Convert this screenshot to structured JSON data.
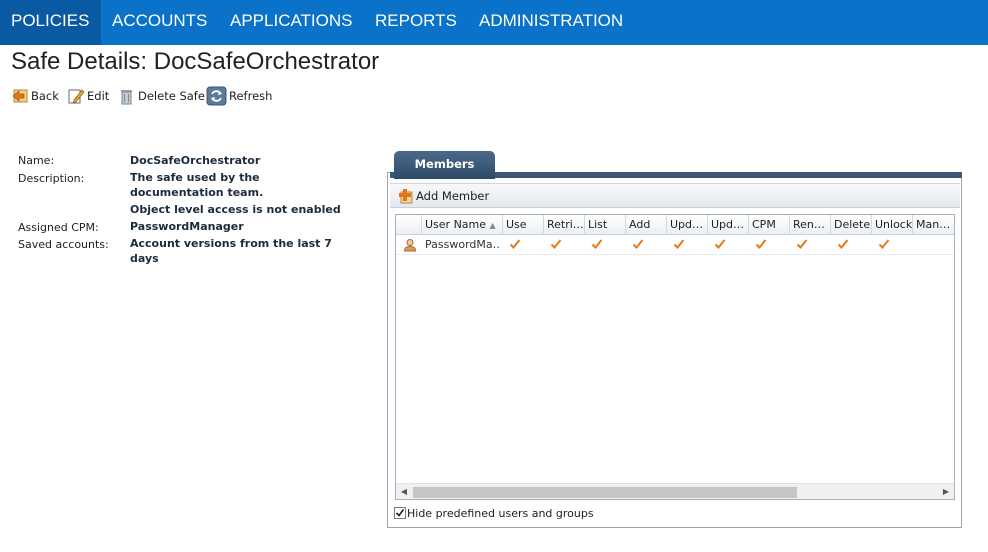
{
  "nav": {
    "items": [
      "POLICIES",
      "ACCOUNTS",
      "APPLICATIONS",
      "REPORTS",
      "ADMINISTRATION"
    ],
    "active": "POLICIES"
  },
  "page": {
    "title": "Safe Details: DocSafeOrchestrator"
  },
  "toolbar": {
    "back": "Back",
    "edit": "Edit",
    "delete_safe": "Delete Safe",
    "refresh": "Refresh"
  },
  "details": {
    "name_label": "Name:",
    "name_value": "DocSafeOrchestrator",
    "description_label": "Description:",
    "description_line1": "The safe used by the",
    "description_line2": "documentation team.",
    "object_access": "Object level access is not enabled",
    "cpm_label": "Assigned CPM:",
    "cpm_value": "PasswordManager",
    "saved_label": "Saved accounts:",
    "saved_line1": "Account versions from the last 7",
    "saved_line2": "days"
  },
  "members": {
    "tab_label": "Members",
    "add_member": "Add Member",
    "columns": [
      "User Name",
      "Use",
      "Retri…",
      "List",
      "Add",
      "Upd…",
      "Upd…",
      "CPM",
      "Ren…",
      "Delete",
      "Unlock",
      "Man…"
    ],
    "sort_column": "User Name",
    "rows": [
      {
        "user": "PasswordMa…",
        "use": true,
        "retrieve": true,
        "list": true,
        "add": true,
        "update1": true,
        "update2": true,
        "cpm": true,
        "rename": true,
        "delete": true,
        "unlock": true,
        "manage": false
      }
    ],
    "hide_predefined_label": "Hide predefined users and groups",
    "hide_predefined_checked": true
  },
  "colors": {
    "nav_bg": "#0a72c8",
    "nav_active": "#0a5aa3",
    "tab_bg": "#3b5878",
    "check": "#e07b1a"
  }
}
